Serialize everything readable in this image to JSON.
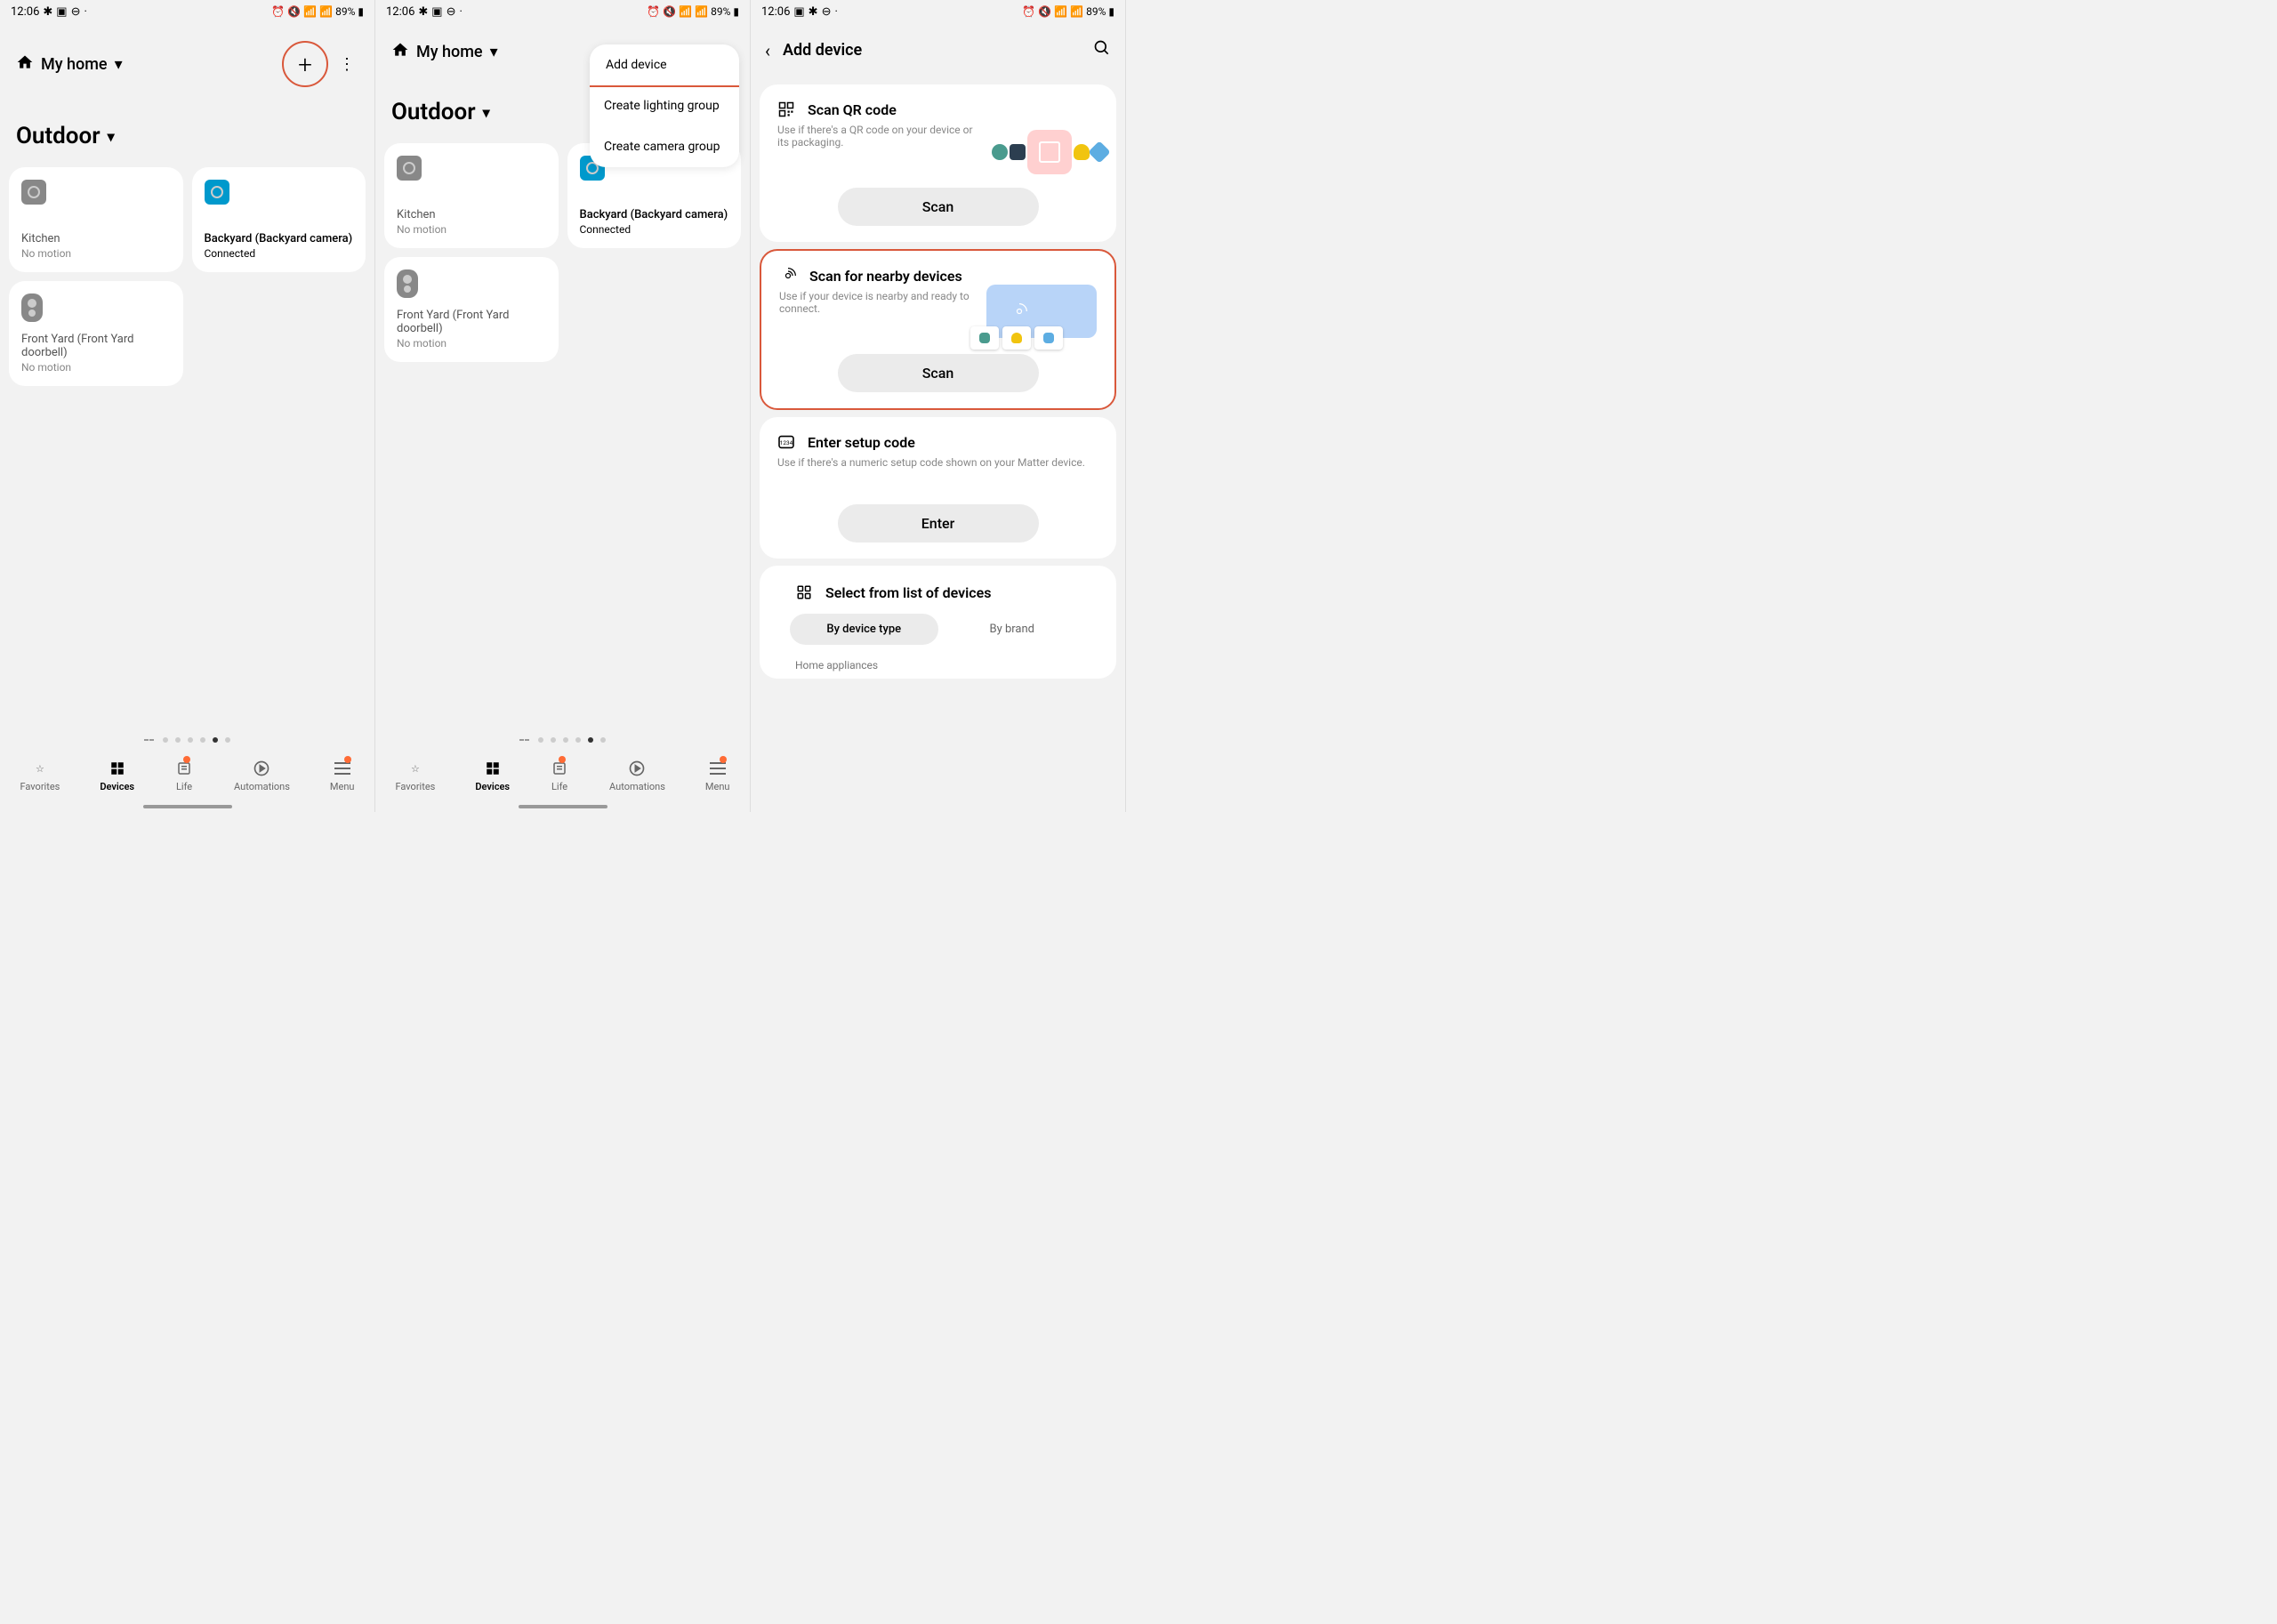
{
  "status": {
    "time": "12:06",
    "battery": "89%"
  },
  "home": {
    "label": "My home"
  },
  "room": {
    "label": "Outdoor"
  },
  "devices": [
    {
      "name": "Kitchen",
      "status": "No motion",
      "active": false,
      "type": "camera"
    },
    {
      "name": "Backyard (Backyard camera)",
      "status": "Connected",
      "active": true,
      "type": "camera"
    },
    {
      "name": "Front Yard (Front Yard doorbell)",
      "status": "No motion",
      "active": false,
      "type": "doorbell"
    }
  ],
  "nav": {
    "favorites": "Favorites",
    "devices": "Devices",
    "life": "Life",
    "automations": "Automations",
    "menu": "Menu"
  },
  "popup": {
    "add_device": "Add device",
    "lighting_group": "Create lighting group",
    "camera_group": "Create camera group"
  },
  "add_device_page": {
    "title": "Add device",
    "qr": {
      "title": "Scan QR code",
      "desc": "Use if there's a QR code on your device or its packaging.",
      "button": "Scan"
    },
    "nearby": {
      "title": "Scan for nearby devices",
      "desc": "Use if your device is nearby and ready to connect.",
      "button": "Scan"
    },
    "setup": {
      "title": "Enter setup code",
      "desc": "Use if there's a numeric setup code shown on your Matter device.",
      "button": "Enter"
    },
    "select": {
      "title": "Select from list of devices",
      "by_type": "By device type",
      "by_brand": "By brand",
      "category": "Home appliances"
    }
  }
}
